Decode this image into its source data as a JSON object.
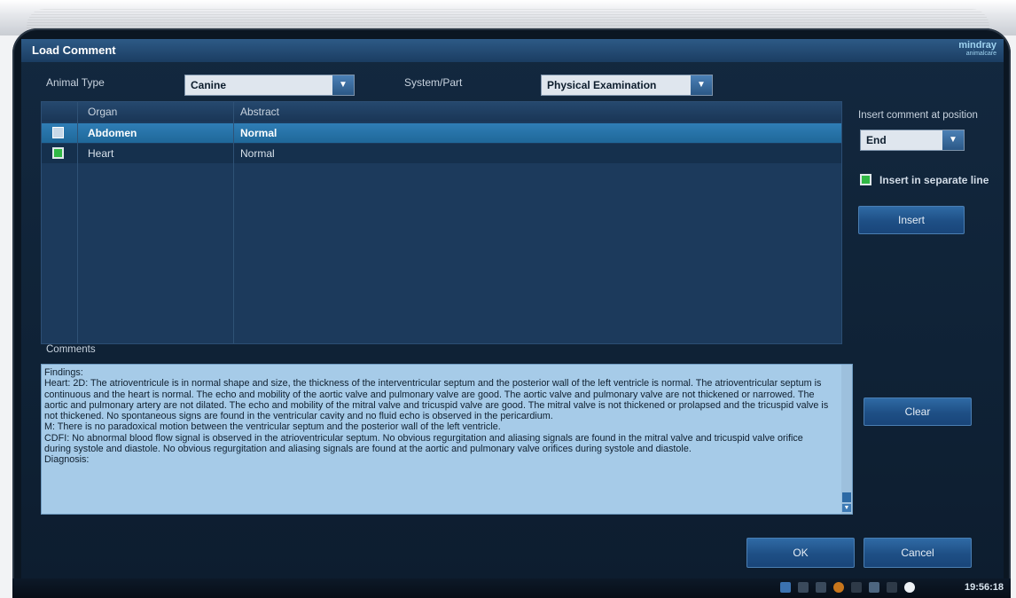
{
  "dialog": {
    "title": "Load Comment",
    "brand": "mindray",
    "brand_sub": "animalcare"
  },
  "filters": {
    "animal_type_label": "Animal Type",
    "animal_type_value": "Canine",
    "system_part_label": "System/Part",
    "system_part_value": "Physical Examination"
  },
  "table": {
    "headers": [
      "Organ",
      "Abstract"
    ],
    "rows": [
      {
        "organ": "Abdomen",
        "abstract": "Normal",
        "checked": false,
        "selected": true
      },
      {
        "organ": "Heart",
        "abstract": "Normal",
        "checked": true,
        "selected": false
      }
    ]
  },
  "side": {
    "insert_position_label": "Insert comment at position",
    "insert_position_value": "End",
    "separate_line_label": "Insert in separate line",
    "separate_line_checked": true,
    "insert_button": "Insert",
    "clear_button": "Clear"
  },
  "comments": {
    "label": "Comments",
    "text": "Findings:\nHeart: 2D: The atrioventricule is in normal shape and size, the thickness of the interventricular septum and the posterior wall of the left ventricle is normal. The atrioventricular septum is continuous and the heart is normal. The echo and mobility of the aortic valve and pulmonary valve are good. The aortic valve and pulmonary valve are not thickened or narrowed. The aortic and pulmonary artery are not dilated. The echo and mobility of the mitral valve and tricuspid valve are good. The mitral valve is not thickened or prolapsed and the tricuspid valve is not thickened. No spontaneous signs are found in the ventricular cavity and no fluid echo is observed in the pericardium.\nM: There is no paradoxical motion between the ventricular septum and the posterior wall of the left ventricle.\nCDFI: No abnormal blood flow signal is observed in the atrioventricular septum. No obvious regurgitation and aliasing signals are found in the mitral valve and tricuspid valve orifice during systole and diastole. No obvious regurgitation and aliasing signals are found at the aortic and pulmonary valve orifices during systole and diastole.\nDiagnosis:"
  },
  "footer": {
    "ok_button": "OK",
    "cancel_button": "Cancel"
  },
  "taskbar": {
    "clock": "19:56:18",
    "tray_icons": [
      "camera-icon",
      "network-icon",
      "wifi-icon",
      "lock-icon",
      "printer-icon",
      "storage-icon",
      "usb-icon",
      "power-icon"
    ]
  },
  "colors": {
    "accent": "#1f6899",
    "checked": "#31b845",
    "background": "#13283f"
  }
}
